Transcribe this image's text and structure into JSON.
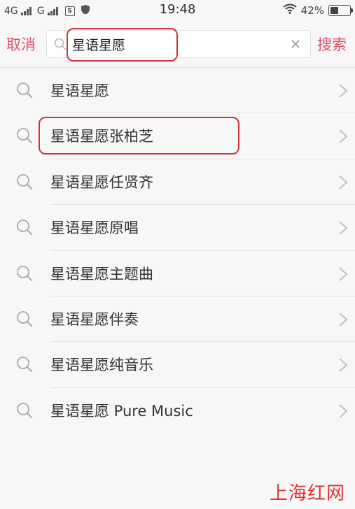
{
  "status_bar": {
    "network1": "4G",
    "network2": "G",
    "sim_icon_text": "S",
    "time": "19:48",
    "battery_percent": "42%",
    "battery_level": 0.42
  },
  "search": {
    "cancel_label": "取消",
    "query": "星语星愿",
    "search_label": "搜索"
  },
  "suggestions": [
    {
      "label": "星语星愿"
    },
    {
      "label": "星语星愿张柏芝"
    },
    {
      "label": "星语星愿任贤齐"
    },
    {
      "label": "星语星愿原唱"
    },
    {
      "label": "星语星愿主题曲"
    },
    {
      "label": "星语星愿伴奏"
    },
    {
      "label": "星语星愿纯音乐"
    },
    {
      "label": "星语星愿 Pure Music"
    }
  ],
  "watermark": "上海红网",
  "colors": {
    "accent": "#e0506b",
    "highlight_box": "#c9363d"
  }
}
